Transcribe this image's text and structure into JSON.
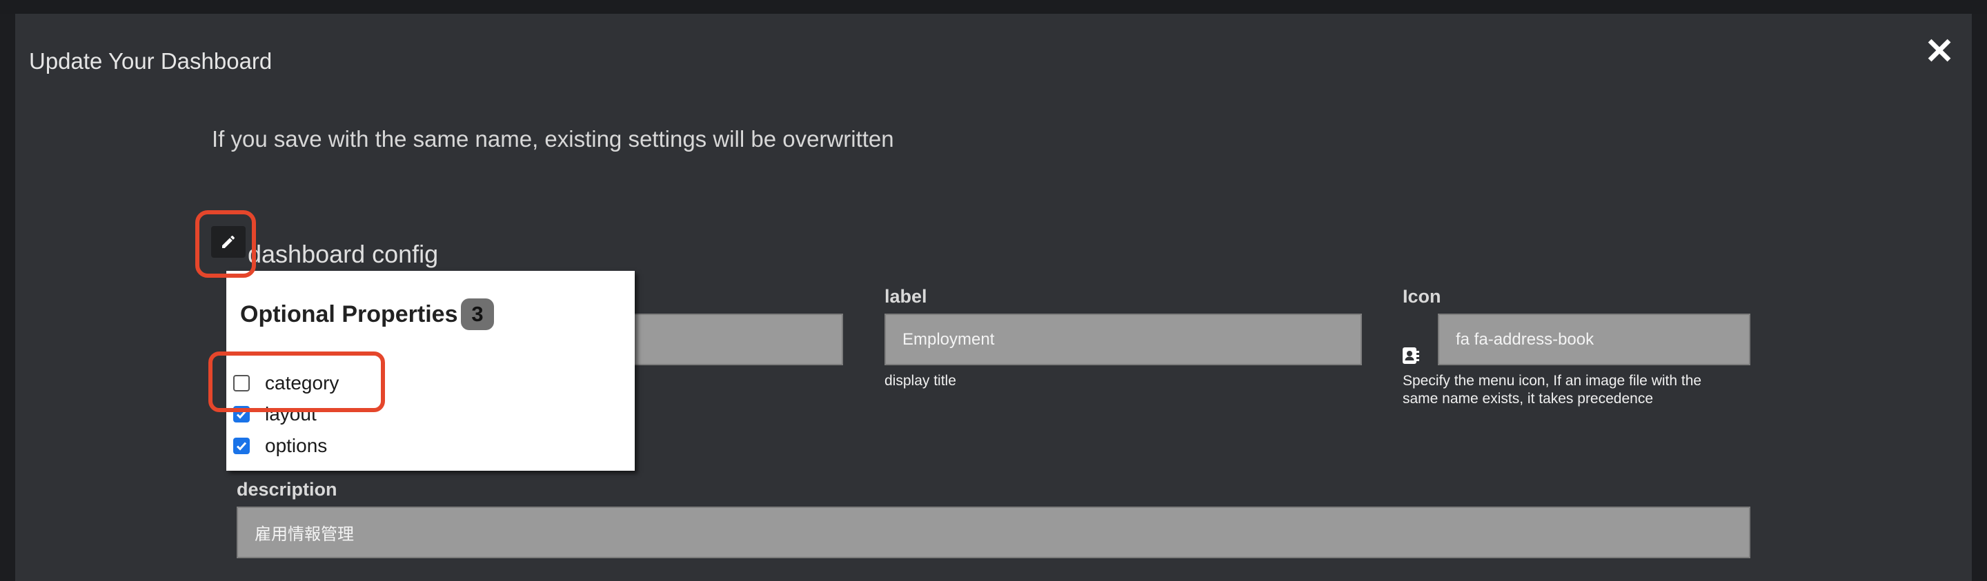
{
  "modal": {
    "title": "Update Your Dashboard",
    "close_icon": "close-icon"
  },
  "notice": "If you save with the same name, existing settings will be overwritten",
  "section": {
    "title": "dashboard config",
    "edit_icon": "pencil-icon"
  },
  "fields": {
    "name": {
      "value": ""
    },
    "label": {
      "label": "label",
      "value": "Employment",
      "help": "display title"
    },
    "icon": {
      "label": "Icon",
      "value": "fa fa-address-book",
      "help_line1": "Specify the menu icon, If an image file with the",
      "help_line2": "same name exists, it takes precedence",
      "prefix_icon": "address-book-icon"
    },
    "description": {
      "label": "description",
      "value": "雇用情報管理"
    }
  },
  "optional_properties": {
    "title": "Optional Properties",
    "count": "3",
    "items": [
      {
        "label": "category",
        "checked": false
      },
      {
        "label": "layout",
        "checked": true
      },
      {
        "label": "options",
        "checked": true
      }
    ]
  },
  "colors": {
    "modal_bg": "#303236",
    "input_bg": "#9a9a9a",
    "highlight": "#e5462b",
    "checkbox_on": "#1a73e8"
  }
}
